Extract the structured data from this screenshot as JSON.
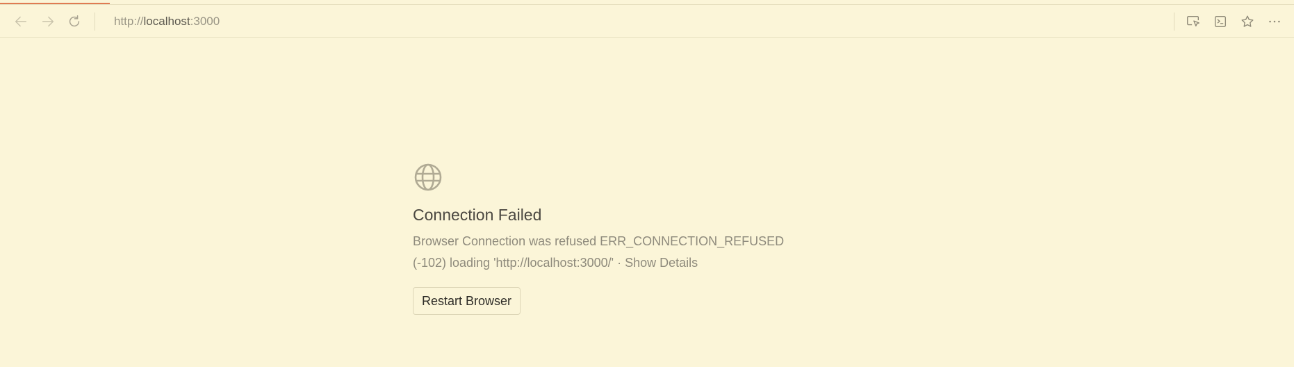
{
  "browser": {
    "url_scheme": "http://",
    "url_host": "localhost",
    "url_port": ":3000",
    "page_load_progress": 0.085
  },
  "toolbar": {
    "icons": {
      "back": "arrow-left-icon",
      "forward": "arrow-right-icon",
      "reload": "reload-icon",
      "select_element": "select-element-icon",
      "console": "terminal-icon",
      "favorite": "star-icon",
      "more": "more-horizontal-icon"
    }
  },
  "error": {
    "icon": "globe-icon",
    "title": "Connection Failed",
    "message_line1": "Browser Connection was refused ERR_CONNECTION_REFUSED",
    "message_line2": "(-102) loading 'http://localhost:3000/'",
    "separator": " · ",
    "show_details_label": "Show Details",
    "restart_button_label": "Restart Browser"
  },
  "colors": {
    "background": "#fbf5d8",
    "progress_bar": "#e07b52",
    "icon_gray": "#b9b39c",
    "text_dark": "#4a4740",
    "text_muted": "#8e8a7c"
  }
}
